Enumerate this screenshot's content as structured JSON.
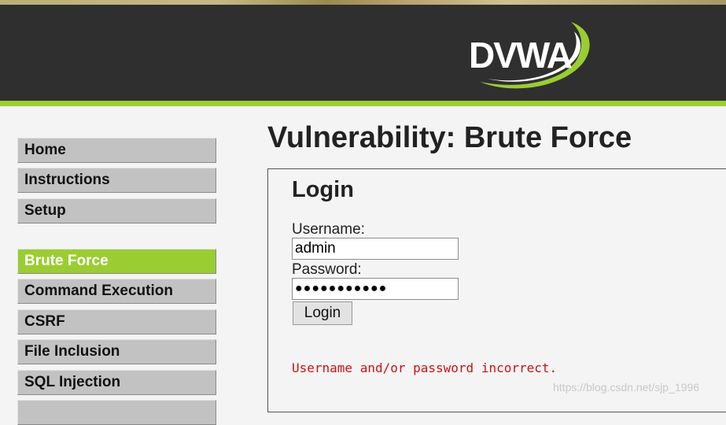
{
  "header": {
    "logo_text": "DVWA",
    "colors": {
      "header_bg": "#2f2f2f",
      "accent": "#9acd32",
      "error": "#cc1111"
    }
  },
  "menu": {
    "items": [
      {
        "label": "Home"
      },
      {
        "label": "Instructions"
      },
      {
        "label": "Setup"
      },
      {
        "label": "Brute Force",
        "selected": true
      },
      {
        "label": "Command Execution"
      },
      {
        "label": "CSRF"
      },
      {
        "label": "File Inclusion"
      },
      {
        "label": "SQL Injection"
      }
    ]
  },
  "main": {
    "title": "Vulnerability: Brute Force",
    "login_heading": "Login",
    "username_label": "Username:",
    "username_value": "admin",
    "password_label": "Password:",
    "password_value_masked": "●●●●●●●●●●●",
    "login_button": "Login",
    "error_message": "Username and/or password incorrect."
  },
  "watermark": "https://blog.csdn.net/sjp_1996"
}
